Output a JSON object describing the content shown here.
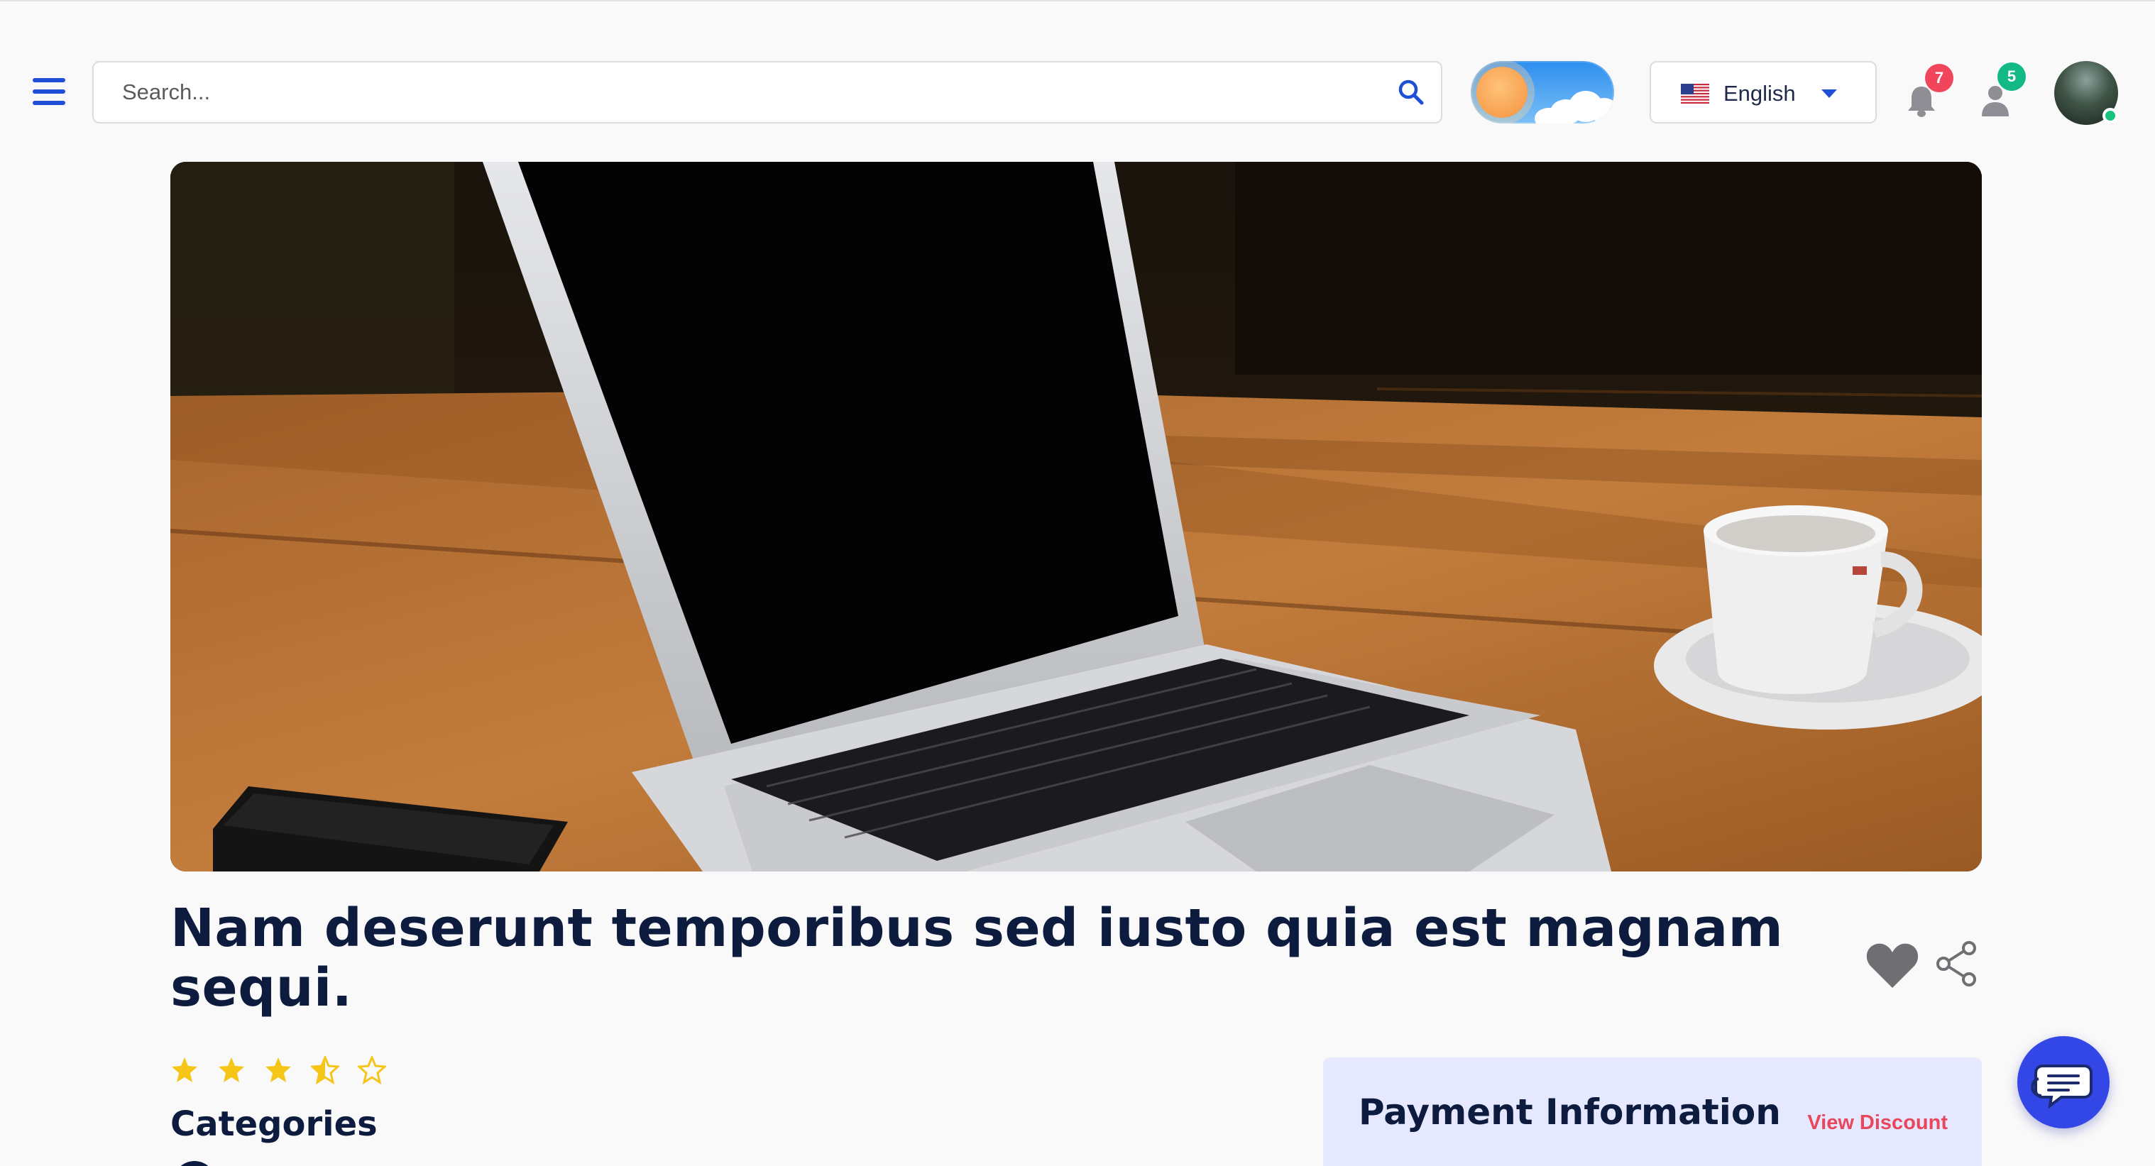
{
  "header": {
    "search": {
      "placeholder": "Search...",
      "value": ""
    },
    "theme_toggle": {
      "state": "light"
    },
    "language": {
      "label": "English",
      "flag": "us-flag-icon"
    },
    "notifications": {
      "count": "7",
      "color": "#f0455a"
    },
    "users": {
      "count": "5",
      "color": "#12b886"
    },
    "avatar": {
      "status": "online"
    }
  },
  "main": {
    "hero_image": "laptop-on-wooden-table-with-coffee-cup",
    "title": "Nam deserunt temporibus sed iusto quia est magnam sequi.",
    "rating": {
      "value": 3.5,
      "max": 5
    },
    "categories_heading": "Categories",
    "payment": {
      "title": "Payment Information",
      "view_discount": "View Discount"
    }
  },
  "colors": {
    "accent": "#1f4fd6",
    "heading": "#0d1b3e",
    "star": "#f5c518",
    "discount": "#e8475c",
    "payment_bg": "#e5e8ff",
    "chat": "#3346e6"
  }
}
